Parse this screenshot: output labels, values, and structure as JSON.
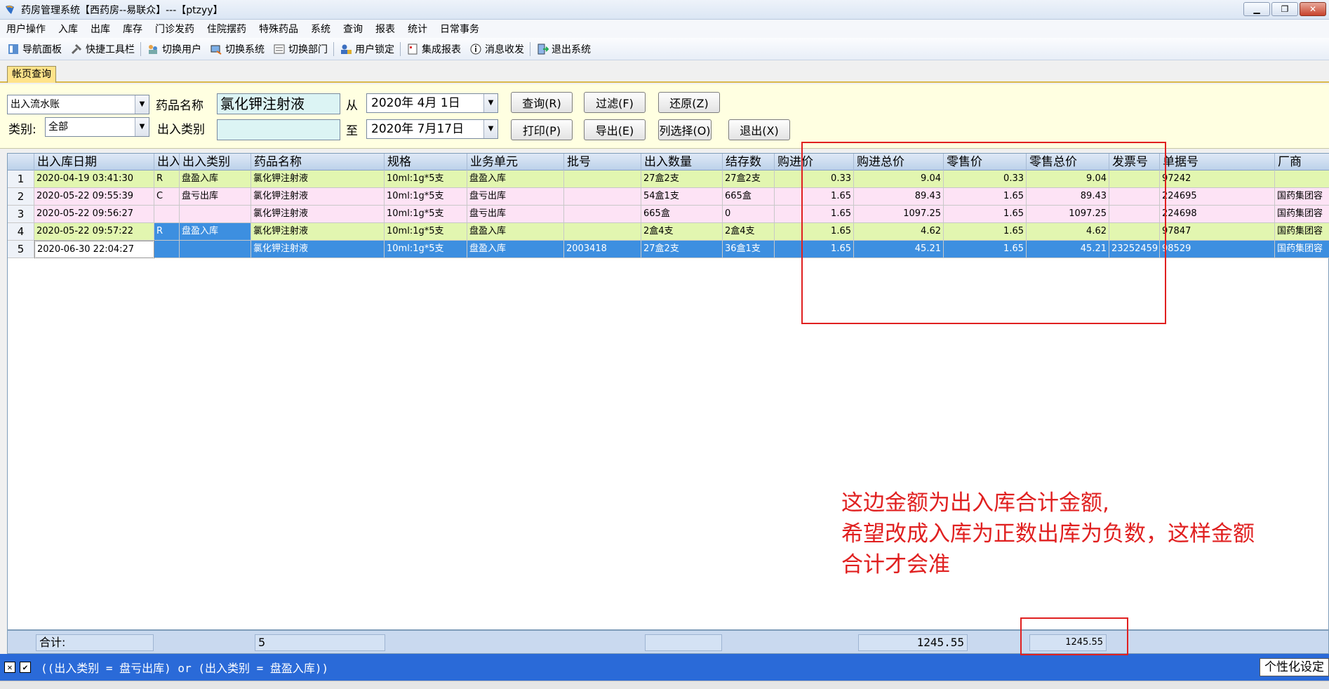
{
  "window": {
    "title": "药房管理系统【西药房--易联众】---【ptzyy】",
    "buttons": {
      "minimize": "▁",
      "maximize": "❐",
      "close": "✕"
    }
  },
  "menu": [
    "用户操作",
    "入库",
    "出库",
    "库存",
    "门诊发药",
    "住院摆药",
    "特殊药品",
    "系统",
    "查询",
    "报表",
    "统计",
    "日常事务"
  ],
  "toolbar": [
    "导航面板",
    "快捷工具栏",
    "切换用户",
    "切换系统",
    "切换部门",
    "用户锁定",
    "集成报表",
    "消息收发",
    "退出系统"
  ],
  "tab": {
    "label": "帐页查询"
  },
  "filter": {
    "mode_select": "出入流水账",
    "category_label": "类别:",
    "category_select": "全部",
    "drug_name_label": "药品名称",
    "drug_name_value": "氯化钾注射液",
    "io_type_label": "出入类别",
    "io_type_value": "",
    "from_label": "从",
    "from_date": "2020年 4月 1日",
    "to_label": "至",
    "to_date": "2020年 7月17日",
    "buttons": {
      "query": "查询(R)",
      "filter": "过滤(F)",
      "restore": "还原(Z)",
      "print": "打印(P)",
      "export": "导出(E)",
      "columns": "列选择(O)",
      "exit": "退出(X)"
    }
  },
  "grid": {
    "columns": [
      "出入库日期",
      "出入",
      "出入类别",
      "药品名称",
      "规格",
      "业务单元",
      "批号",
      "出入数量",
      "结存数",
      "购进价",
      "购进总价",
      "零售价",
      "零售总价",
      "发票号",
      "单据号",
      "厂商"
    ],
    "rows": [
      {
        "no": "1",
        "cells": [
          "2020-04-19 03:41:30",
          "R",
          "盘盈入库",
          "氯化钾注射液",
          "10ml:1g*5支",
          "盘盈入库",
          "",
          "27盒2支",
          "27盒2支",
          "0.33",
          "9.04",
          "0.33",
          "9.04",
          "",
          "97242",
          ""
        ]
      },
      {
        "no": "2",
        "cells": [
          "2020-05-22 09:55:39",
          "C",
          "盘亏出库",
          "氯化钾注射液",
          "10ml:1g*5支",
          "盘亏出库",
          "",
          "54盒1支",
          "665盒",
          "1.65",
          "89.43",
          "1.65",
          "89.43",
          "",
          "224695",
          "国药集团容"
        ]
      },
      {
        "no": "3",
        "cells": [
          "2020-05-22 09:56:27",
          "",
          "",
          "氯化钾注射液",
          "10ml:1g*5支",
          "盘亏出库",
          "",
          "665盒",
          "0",
          "1.65",
          "1097.25",
          "1.65",
          "1097.25",
          "",
          "224698",
          "国药集团容"
        ]
      },
      {
        "no": "4",
        "cells": [
          "2020-05-22 09:57:22",
          "R",
          "盘盈入库",
          "氯化钾注射液",
          "10ml:1g*5支",
          "盘盈入库",
          "",
          "2盒4支",
          "2盒4支",
          "1.65",
          "4.62",
          "1.65",
          "4.62",
          "",
          "97847",
          "国药集团容"
        ]
      },
      {
        "no": "5",
        "cells": [
          "2020-06-30 22:04:27",
          "",
          "",
          "氯化钾注射液",
          "10ml:1g*5支",
          "盘盈入库",
          "2003418",
          "27盒2支",
          "36盒1支",
          "1.65",
          "45.21",
          "1.65",
          "45.21",
          "23252459",
          "98529",
          "国药集团容"
        ]
      }
    ],
    "row_colors": [
      "#e2f6b0",
      "#fde3f5",
      "#fde3f5",
      "#e2f6b0",
      "#3d8fe0"
    ]
  },
  "footer": {
    "label": "合计:",
    "count": "5",
    "qty_total": "",
    "purchase_total": "1245.55",
    "retail_total": "1245.55"
  },
  "status": {
    "filter_text": "((出入类别 = 盘亏出库) or (出入类别 = 盘盈入库))",
    "personalize": "个性化设定"
  },
  "annotation": {
    "lines": [
      "这边金额为出入库合计金额,",
      "希望改成入库为正数出库为负数，这样金额",
      "合计才会准"
    ],
    "color": "#e02020"
  }
}
